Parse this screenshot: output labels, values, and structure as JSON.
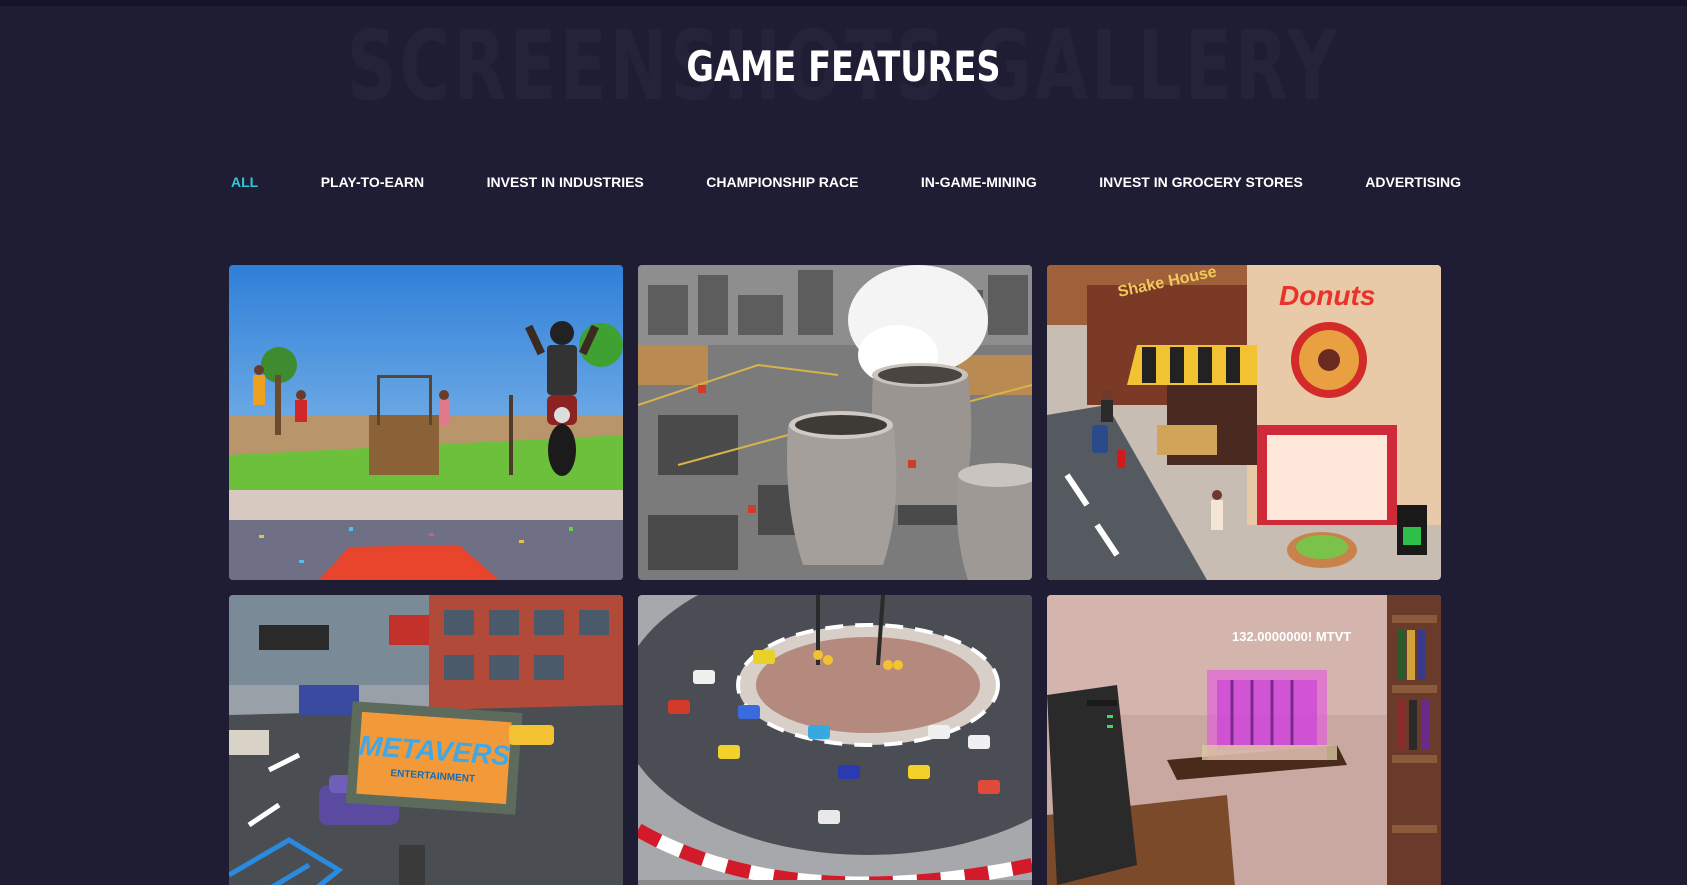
{
  "section": {
    "background_title": "SCREENSHOTS GALLERY",
    "title": "GAME FEATURES"
  },
  "filters": [
    {
      "label": "ALL",
      "active": true
    },
    {
      "label": "PLAY-TO-EARN",
      "active": false
    },
    {
      "label": "INVEST IN INDUSTRIES",
      "active": false
    },
    {
      "label": "CHAMPIONSHIP RACE",
      "active": false
    },
    {
      "label": "IN-GAME-MINING",
      "active": false
    },
    {
      "label": "INVEST IN GROCERY STORES",
      "active": false
    },
    {
      "label": "ADVERTISING",
      "active": false
    }
  ],
  "colors": {
    "background": "#1f1d34",
    "active_filter": "#2ec7d7",
    "filter_text": "#ffffff",
    "title": "#ffffff"
  },
  "gallery": {
    "tile_3": {
      "sign_donuts": "Donuts",
      "sign_shop": "Shake House"
    },
    "tile_4": {
      "billboard": "METAVERS",
      "billboard_sub": "ENTERTAINMENT"
    },
    "tile_6": {
      "miner_readout": "132.0000000! MTVT"
    }
  }
}
